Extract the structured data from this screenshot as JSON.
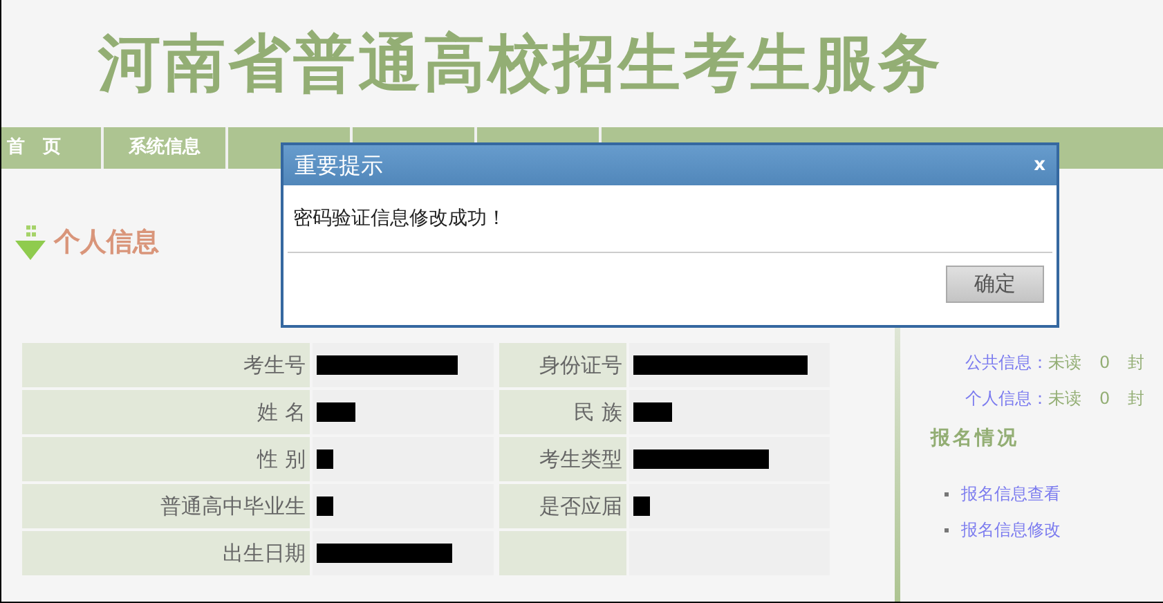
{
  "header": {
    "title": "河南省普通高校招生考生服务"
  },
  "nav": [
    {
      "label": "首　页"
    },
    {
      "label": "系统信息"
    }
  ],
  "section_title": "个人信息",
  "info_rows": [
    {
      "label": "考生号",
      "value": {
        "kind": "redacted-long"
      },
      "label_2": "身份证号",
      "value_2": {
        "kind": "redacted-xlong"
      }
    },
    {
      "label": "姓 名",
      "value": {
        "kind": "redacted-short"
      },
      "label_2": "民 族",
      "value_2": {
        "kind": "redacted-short"
      }
    },
    {
      "label": "性 别",
      "value": {
        "kind": "redacted-tiny"
      },
      "label_2": "考生类型",
      "value_2": {
        "kind": "redacted-medium"
      }
    },
    {
      "label": "普通高中毕业生",
      "value": {
        "kind": "redacted-tiny"
      },
      "label_2": "是否应届",
      "value_2": {
        "kind": "redacted-tiny"
      }
    },
    {
      "label": "出生日期",
      "value": {
        "kind": "redacted-medium"
      }
    }
  ],
  "sidebar": {
    "messages": [
      {
        "label": "公共信息：",
        "status": "未读",
        "count": "0",
        "unit": "封"
      },
      {
        "label": "个人信息：",
        "status": "未读",
        "count": "0",
        "unit": "封"
      }
    ],
    "section_title": "报名情况",
    "links": [
      "报名信息查看",
      "报名信息修改"
    ]
  },
  "dialog": {
    "title": "重要提示",
    "close": "x",
    "message": "密码验证信息修改成功！",
    "button": "确定"
  }
}
